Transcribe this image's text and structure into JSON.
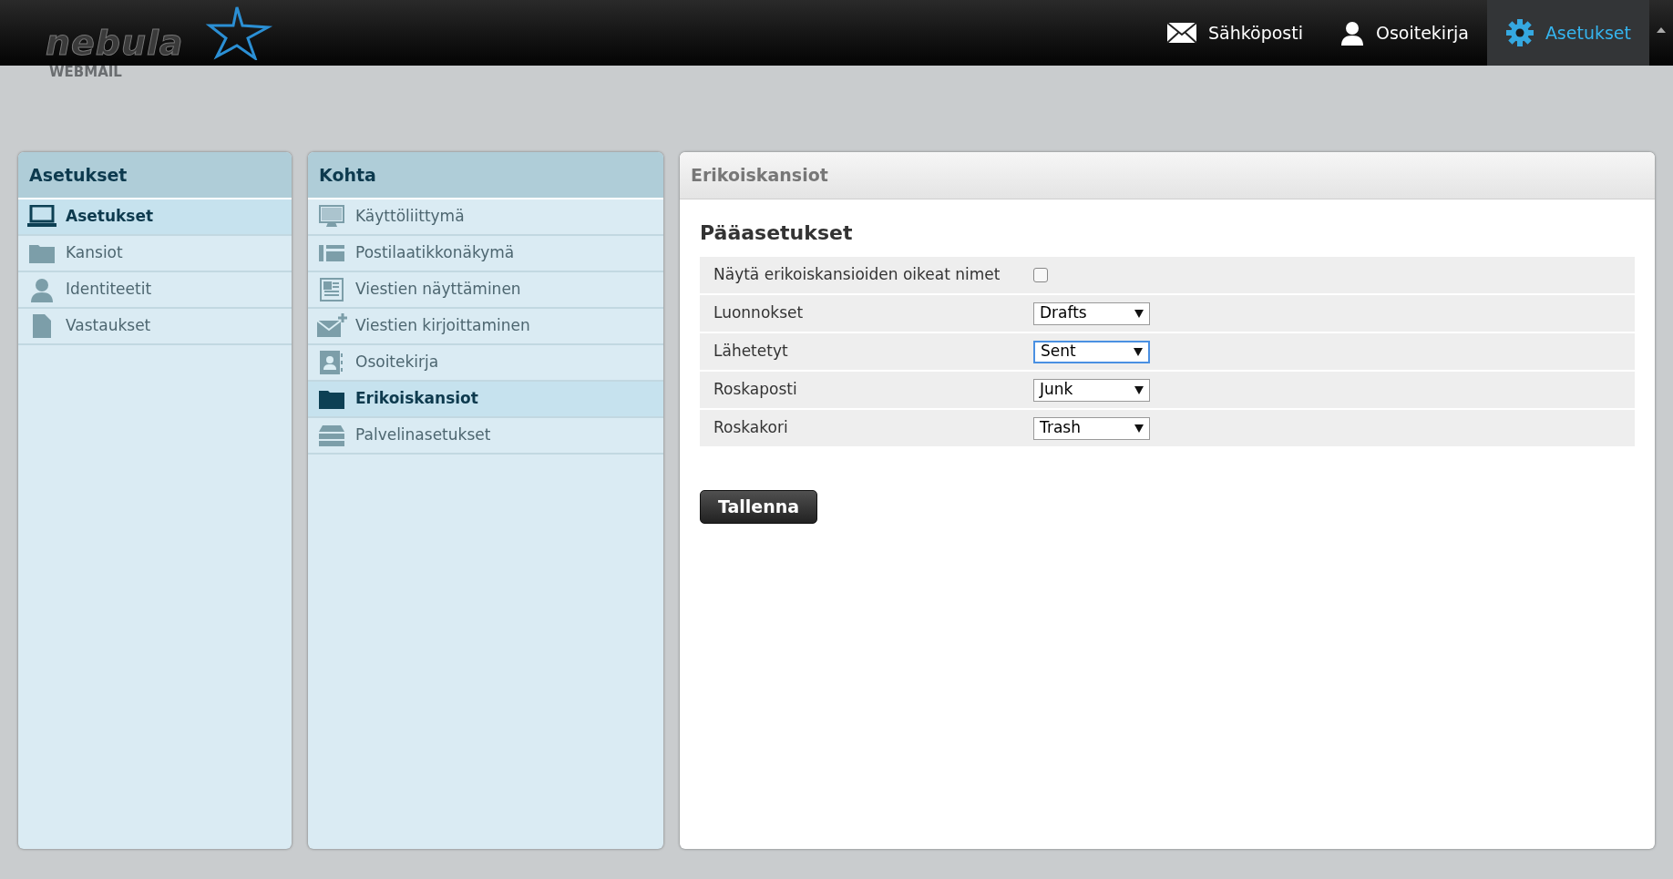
{
  "header": {
    "logo": {
      "name": "nebula",
      "subtitle": "WEBMAIL"
    },
    "nav": [
      {
        "label": "Sähköposti",
        "kind": "mail",
        "selected": false
      },
      {
        "label": "Osoitekirja",
        "kind": "person",
        "selected": false
      },
      {
        "label": "Asetukset",
        "kind": "gear",
        "selected": true
      }
    ]
  },
  "sections_panel": {
    "title": "Asetukset",
    "items": [
      {
        "label": "Asetukset",
        "kind": "laptop",
        "selected": true
      },
      {
        "label": "Kansiot",
        "kind": "folder",
        "selected": false
      },
      {
        "label": "Identiteetit",
        "kind": "person",
        "selected": false
      },
      {
        "label": "Vastaukset",
        "kind": "document",
        "selected": false
      }
    ]
  },
  "items_panel": {
    "title": "Kohta",
    "items": [
      {
        "label": "Käyttöliittymä",
        "kind": "monitor",
        "selected": false
      },
      {
        "label": "Postilaatikkonäkymä",
        "kind": "layout",
        "selected": false
      },
      {
        "label": "Viestien näyttäminen",
        "kind": "page",
        "selected": false
      },
      {
        "label": "Viestien kirjoittaminen",
        "kind": "mailplus",
        "selected": false
      },
      {
        "label": "Osoitekirja",
        "kind": "contact",
        "selected": false
      },
      {
        "label": "Erikoiskansiot",
        "kind": "folder",
        "selected": true
      },
      {
        "label": "Palvelinasetukset",
        "kind": "server",
        "selected": false
      }
    ]
  },
  "content": {
    "title": "Erikoiskansiot",
    "section": "Pääasetukset",
    "rows": [
      {
        "kind": "checkbox",
        "label": "Näytä erikoiskansioiden oikeat nimet",
        "checked": false
      },
      {
        "kind": "select",
        "label": "Luonnokset",
        "value": "Drafts",
        "focused": false
      },
      {
        "kind": "select",
        "label": "Lähetetyt",
        "value": "Sent",
        "focused": true
      },
      {
        "kind": "select",
        "label": "Roskaposti",
        "value": "Junk",
        "focused": false
      },
      {
        "kind": "select",
        "label": "Roskakori",
        "value": "Trash",
        "focused": false
      }
    ],
    "save_button": "Tallenna"
  }
}
